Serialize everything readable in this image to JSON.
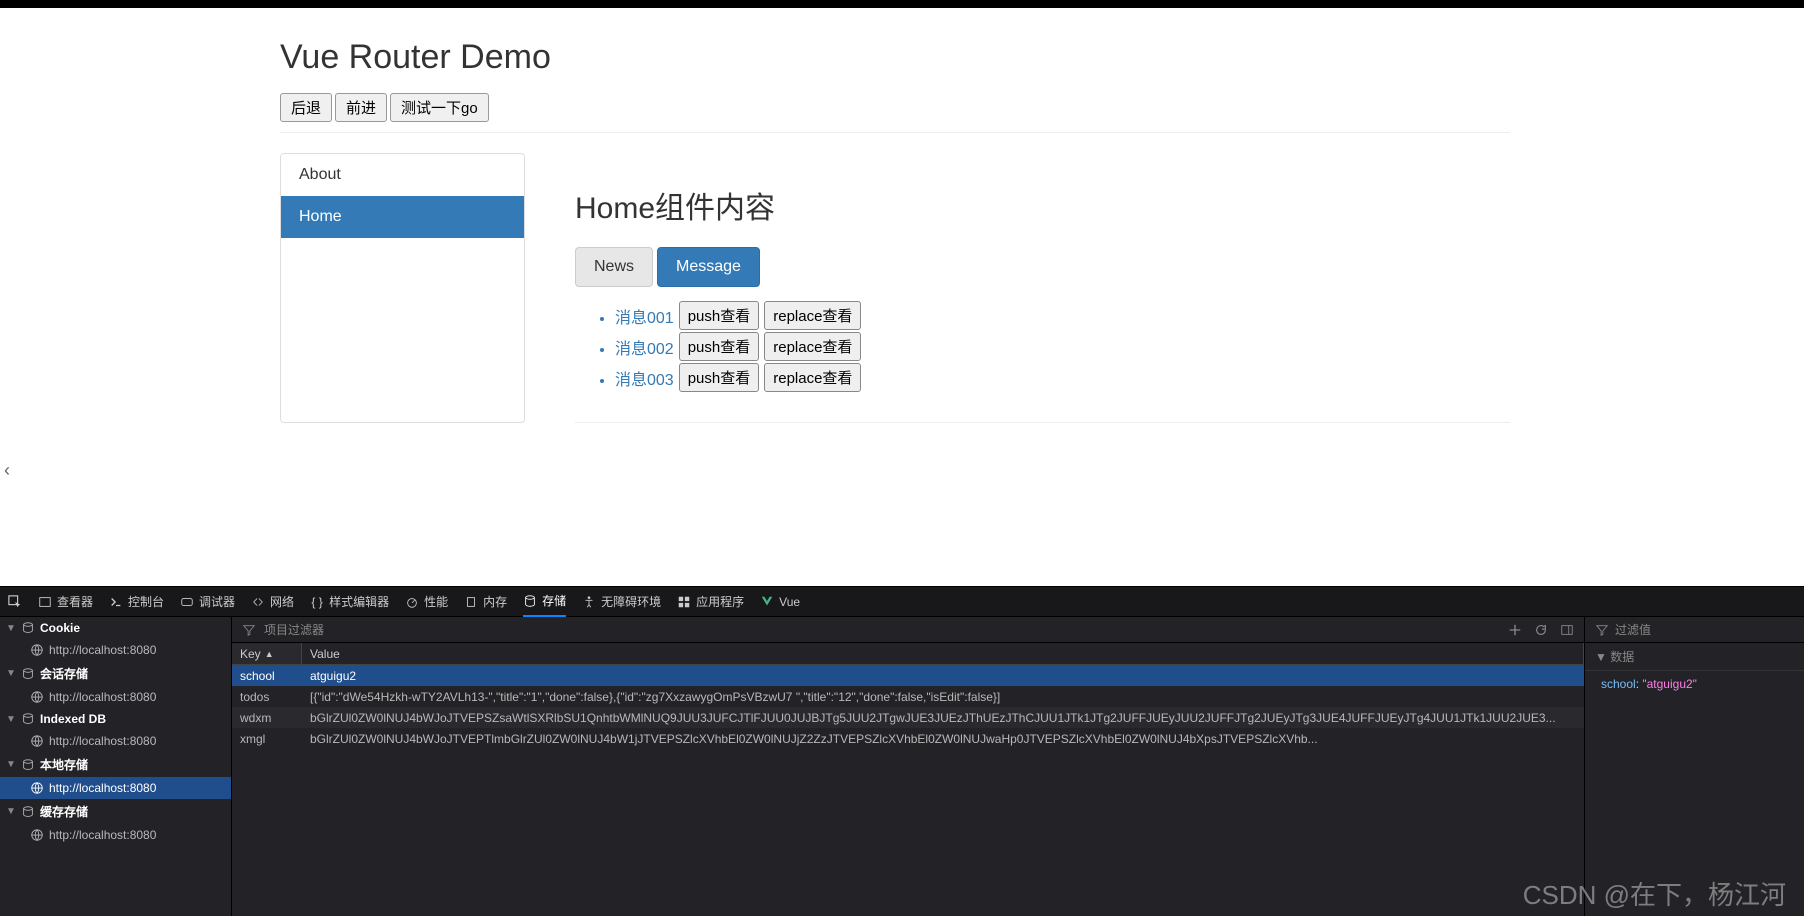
{
  "page": {
    "title": "Vue Router Demo",
    "buttons": {
      "back": "后退",
      "forward": "前进",
      "test": "测试一下go"
    },
    "sidenav": [
      {
        "label": "About",
        "active": false
      },
      {
        "label": "Home",
        "active": true
      }
    ],
    "home": {
      "heading": "Home组件内容",
      "tabs": [
        {
          "label": "News",
          "active": false
        },
        {
          "label": "Message",
          "active": true
        }
      ],
      "messages": [
        {
          "link": "消息001",
          "push": "push查看",
          "replace": "replace查看"
        },
        {
          "link": "消息002",
          "push": "push查看",
          "replace": "replace查看"
        },
        {
          "link": "消息003",
          "push": "push查看",
          "replace": "replace查看"
        }
      ]
    }
  },
  "devtools": {
    "tabs": {
      "inspector": "查看器",
      "console": "控制台",
      "debugger": "调试器",
      "network": "网络",
      "style": "样式编辑器",
      "perf": "性能",
      "memory": "内存",
      "storage": "存储",
      "a11y": "无障碍环境",
      "app": "应用程序",
      "vue": "Vue"
    },
    "left_tree": [
      {
        "type": "group",
        "label": "Cookie"
      },
      {
        "type": "origin",
        "label": "http://localhost:8080"
      },
      {
        "type": "group",
        "label": "会话存储"
      },
      {
        "type": "origin",
        "label": "http://localhost:8080"
      },
      {
        "type": "group",
        "label": "Indexed DB"
      },
      {
        "type": "origin",
        "label": "http://localhost:8080"
      },
      {
        "type": "group",
        "label": "本地存储"
      },
      {
        "type": "origin",
        "label": "http://localhost:8080",
        "selected": true
      },
      {
        "type": "group",
        "label": "缓存存储"
      },
      {
        "type": "origin",
        "label": "http://localhost:8080"
      }
    ],
    "filter_placeholder": "项目过滤器",
    "table": {
      "headers": {
        "key": "Key",
        "value": "Value"
      },
      "rows": [
        {
          "key": "school",
          "value": "atguigu2",
          "selected": true
        },
        {
          "key": "todos",
          "value": "[{\"id\":\"dWe54Hzkh-wTY2AVLh13-\",\"title\":\"1\",\"done\":false},{\"id\":\"zg7XxzawygOmPsVBzwU7  \",\"title\":\"12\",\"done\":false,\"isEdit\":false}]"
        },
        {
          "key": "wdxm",
          "value": "bGlrZUl0ZW0lNUJ4bWJoJTVEPSZsaWtlSXRlbSU1QnhtbWMlNUQ9JUU3JUFCJTlFJUU0JUJBJTg5JUU2JTgwJUE3JUEzJThUEzJThCJUU1JTk1JTg2JUFFJUEyJUU2JUFFJTg2JUEyJTg3JUE4JUFFJUEyJTg4JUU1JTk1JUU2JUE3..."
        },
        {
          "key": "xmgl",
          "value": "bGlrZUl0ZW0lNUJ4bWJoJTVEPTlmbGlrZUl0ZW0lNUJ4bW1jJTVEPSZlcXVhbEl0ZW0lNUJjZ2ZzJTVEPSZlcXVhbEl0ZW0lNUJwaHp0JTVEPSZlcXVhbEl0ZW0lNUJ4bXpsJTVEPSZlcXVhb..."
        }
      ]
    },
    "right": {
      "filter_placeholder": "过滤值",
      "heading": "数据",
      "key": "school",
      "value": "\"atguigu2\""
    }
  },
  "watermark": "CSDN @在下，杨江河"
}
